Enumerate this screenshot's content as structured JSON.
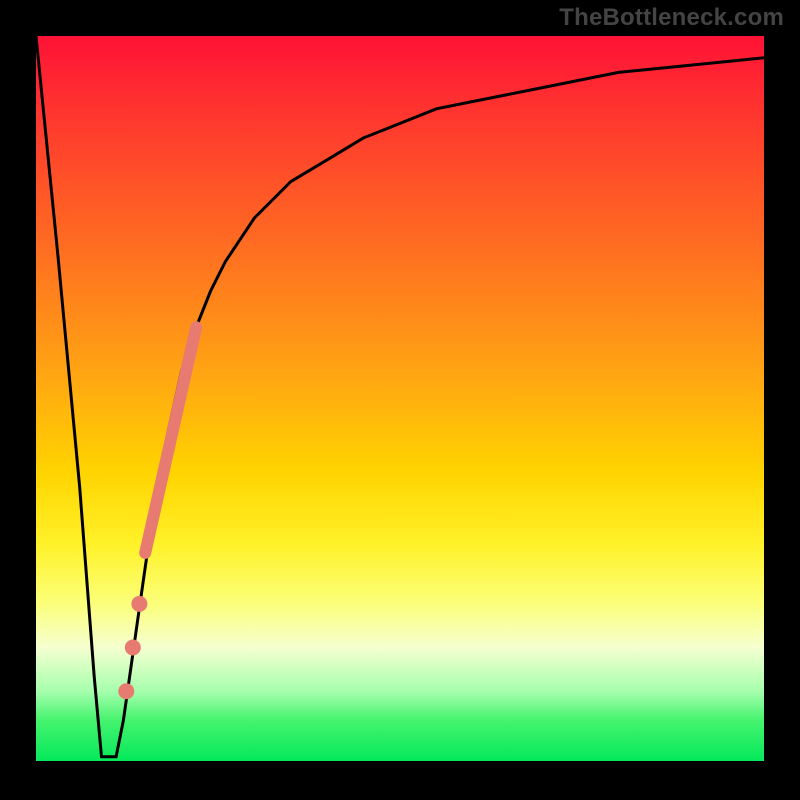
{
  "watermark": "TheBottleneck.com",
  "colors": {
    "background": "#000000",
    "curve_stroke": "#000000",
    "dot_fill": "#e77b71",
    "watermark": "#444444"
  },
  "chart_data": {
    "type": "line",
    "title": "",
    "xlabel": "",
    "ylabel": "",
    "xlim": [
      0,
      100
    ],
    "ylim": [
      0,
      100
    ],
    "grid": false,
    "legend": false,
    "series": [
      {
        "name": "bottleneck-curve",
        "x": [
          0,
          3,
          6,
          8,
          9,
          10,
          11,
          12,
          14,
          16,
          18,
          20,
          22,
          24,
          26,
          30,
          35,
          40,
          45,
          50,
          55,
          60,
          70,
          80,
          90,
          100
        ],
        "values": [
          100,
          70,
          38,
          12,
          1,
          1,
          1,
          6,
          20,
          34,
          45,
          54,
          60,
          65,
          69,
          75,
          80,
          83,
          86,
          88,
          90,
          91,
          93,
          95,
          96,
          97
        ]
      }
    ],
    "annotations": {
      "streak": {
        "x_start": 15,
        "y_start": 29,
        "x_end": 22,
        "y_end": 60,
        "thickness": 12
      },
      "dots": [
        {
          "x": 14.2,
          "y": 22
        },
        {
          "x": 13.3,
          "y": 16
        },
        {
          "x": 12.4,
          "y": 10
        }
      ]
    }
  }
}
